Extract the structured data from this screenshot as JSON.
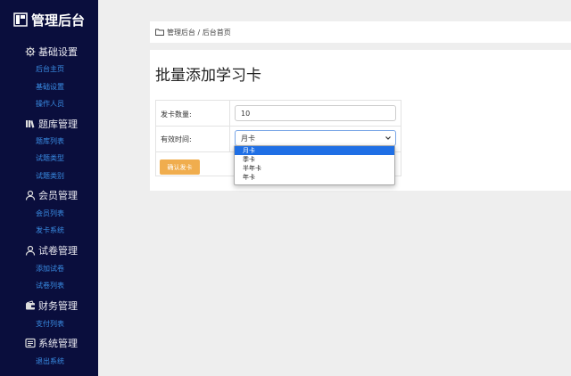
{
  "app": {
    "title": "管理后台"
  },
  "sidebar": {
    "sections": [
      {
        "title": "基础设置",
        "icon": "gear-icon",
        "items": [
          "后台主页",
          "基础设置",
          "操作人员"
        ]
      },
      {
        "title": "题库管理",
        "icon": "books-icon",
        "items": [
          "题库列表",
          "试题类型",
          "试题类别"
        ]
      },
      {
        "title": "会员管理",
        "icon": "user-icon",
        "items": [
          "会员列表",
          "发卡系统"
        ]
      },
      {
        "title": "试卷管理",
        "icon": "user-icon",
        "items": [
          "添加试卷",
          "试卷列表"
        ]
      },
      {
        "title": "财务管理",
        "icon": "wallet-icon",
        "items": [
          "支付列表"
        ]
      },
      {
        "title": "系统管理",
        "icon": "system-icon",
        "items": [
          "退出系统"
        ]
      }
    ]
  },
  "breadcrumb": {
    "text": "管理后台 / 后台首页"
  },
  "page": {
    "title": "批量添加学习卡"
  },
  "form": {
    "quantity_label": "发卡数量:",
    "quantity_value": "10",
    "duration_label": "有效时间:",
    "duration_value": "月卡",
    "duration_options": [
      "月卡",
      "季卡",
      "半年卡",
      "年卡"
    ],
    "submit_label": "确认发卡"
  },
  "colors": {
    "sidebar_bg": "#0a0e3d",
    "link": "#3a8ee6",
    "button": "#f0ad4e",
    "option_selected": "#1f6fe5"
  }
}
